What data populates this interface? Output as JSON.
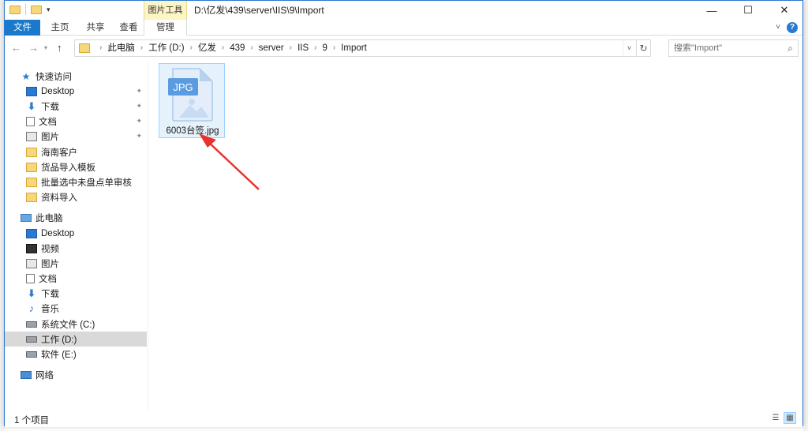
{
  "window": {
    "title_path": "D:\\亿发\\439\\server\\IIS\\9\\Import",
    "contextual_tab_group": "图片工具"
  },
  "window_controls": {
    "minimize_glyph": "—",
    "maximize_glyph": "☐",
    "close_glyph": "✕"
  },
  "ribbon": {
    "tabs": [
      {
        "label": "文件"
      },
      {
        "label": "主页"
      },
      {
        "label": "共享"
      },
      {
        "label": "查看"
      },
      {
        "label": "管理"
      }
    ],
    "help_glyph": "?"
  },
  "address": {
    "breadcrumbs": [
      "此电脑",
      "工作 (D:)",
      "亿发",
      "439",
      "server",
      "IIS",
      "9",
      "Import"
    ],
    "search_placeholder": "搜索\"Import\""
  },
  "navigation": {
    "quick_access": {
      "label": "快速访问",
      "items": [
        {
          "label": "Desktop",
          "icon": "desktop-icon",
          "pinned": true
        },
        {
          "label": "下载",
          "icon": "download-icon",
          "pinned": true
        },
        {
          "label": "文档",
          "icon": "document-icon",
          "pinned": true
        },
        {
          "label": "图片",
          "icon": "picture-icon",
          "pinned": true
        },
        {
          "label": "海南客户",
          "icon": "folder-icon",
          "pinned": false
        },
        {
          "label": "货品导入模板",
          "icon": "folder-icon",
          "pinned": false
        },
        {
          "label": "批量选中未盘点单审核",
          "icon": "folder-icon",
          "pinned": false
        },
        {
          "label": "资料导入",
          "icon": "folder-icon",
          "pinned": false
        }
      ]
    },
    "this_pc": {
      "label": "此电脑",
      "items": [
        {
          "label": "Desktop",
          "icon": "desktop-icon"
        },
        {
          "label": "视频",
          "icon": "video-icon"
        },
        {
          "label": "图片",
          "icon": "picture-icon"
        },
        {
          "label": "文档",
          "icon": "document-icon"
        },
        {
          "label": "下载",
          "icon": "download-icon"
        },
        {
          "label": "音乐",
          "icon": "music-icon"
        },
        {
          "label": "系统文件 (C:)",
          "icon": "drive-icon"
        },
        {
          "label": "工作 (D:)",
          "icon": "drive-icon",
          "selected": true
        },
        {
          "label": "软件 (E:)",
          "icon": "drive-icon"
        }
      ]
    },
    "network": {
      "label": "网络"
    }
  },
  "content": {
    "files": [
      {
        "name": "6003台签.jpg",
        "type_badge": "JPG",
        "selected": true
      }
    ]
  },
  "status": {
    "item_count": "1 个项目"
  },
  "colors": {
    "accent": "#1979ca",
    "selection_bg": "#e5f1fb",
    "selection_border": "#99d1ff",
    "annotation_arrow": "#e8322f",
    "contextual_tab": "#fdf5c5"
  }
}
